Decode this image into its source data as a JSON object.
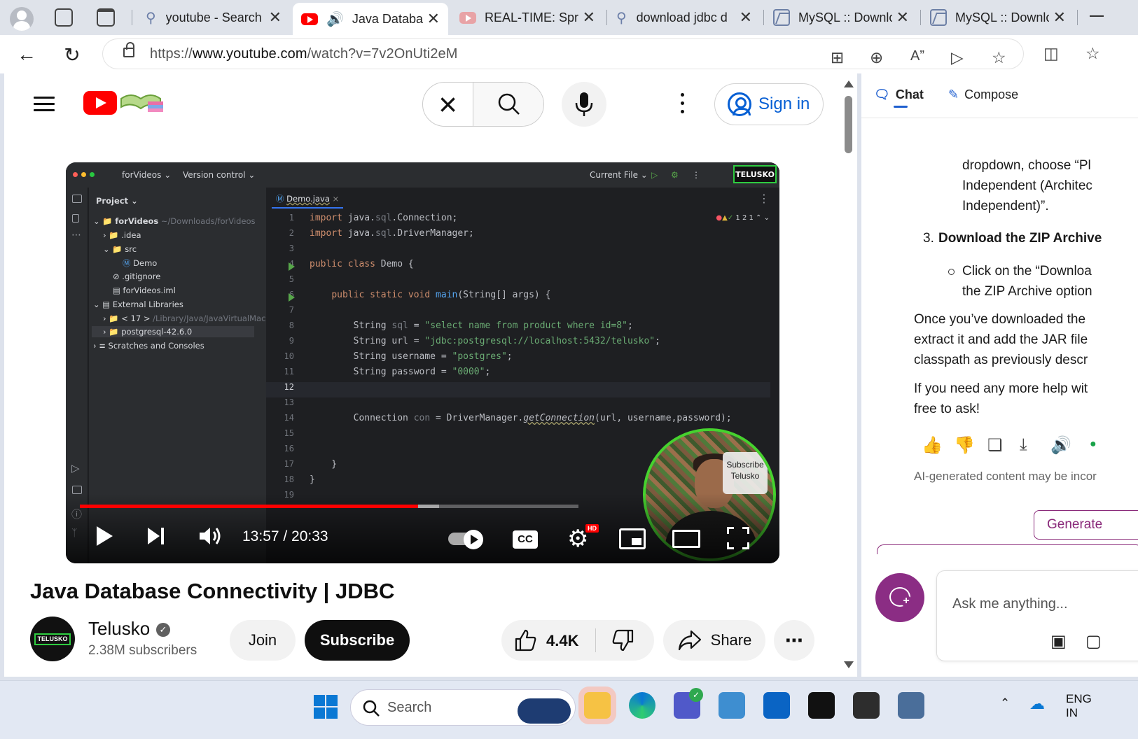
{
  "browser": {
    "tabs": [
      {
        "title": "youtube - Search",
        "icon": "search-icon"
      },
      {
        "title": "Java Databa",
        "icon": "youtube-icon",
        "active": true
      },
      {
        "title": "REAL-TIME: Sprin",
        "icon": "youtube-icon"
      },
      {
        "title": "download jdbc d",
        "icon": "search-icon"
      },
      {
        "title": "MySQL :: Downlo",
        "icon": "mysql-icon"
      },
      {
        "title": "MySQL :: Downlo",
        "icon": "mysql-icon"
      }
    ],
    "url_prefix": "https://",
    "url_host": "www.youtube.com",
    "url_path": "/watch?v=7v2OnUti2eM"
  },
  "youtube": {
    "signin_label": "Sign in",
    "video": {
      "title": "Java Database Connectivity | JDBC",
      "current_time": "13:57",
      "duration": "20:33",
      "time_display": "13:57 / 20:33",
      "progress_played": 0.679,
      "progress_buffered": 0.72,
      "cc_label": "CC",
      "hd_label": "HD"
    },
    "channel": {
      "name": "Telusko",
      "subscribers": "2.38M subscribers",
      "avatar_text": "TELUSKO"
    },
    "actions": {
      "join": "Join",
      "subscribe": "Subscribe",
      "likes": "4.4K",
      "share": "Share"
    }
  },
  "ide": {
    "project_name": "forVideos",
    "version_control": "Version control",
    "run_config": "Current File",
    "badge": "TELUSKO",
    "project_label": "Project",
    "tree": [
      {
        "label": "forVideos",
        "extra": "~/Downloads/forVideos"
      },
      {
        "label": ".idea"
      },
      {
        "label": "src"
      },
      {
        "label": "Demo"
      },
      {
        "label": ".gitignore"
      },
      {
        "label": "forVideos.iml"
      },
      {
        "label": "External Libraries"
      },
      {
        "label": "< 17 >",
        "extra": "/Library/Java/JavaVirtualMachir"
      },
      {
        "label": "postgresql-42.6.0"
      },
      {
        "label": "Scratches and Consoles"
      }
    ],
    "editor_tab": "Demo.java",
    "inspections": "1  2  1",
    "code": [
      "import java.sql.Connection;",
      "import java.sql.DriverManager;",
      "",
      "public class Demo {",
      "",
      "    public static void main(String[] args) {",
      "",
      "        String sql = \"select name from product where id=8\";",
      "        String url = \"jdbc:postgresql://localhost:5432/telusko\";",
      "        String username = \"postgres\";",
      "        String password = \"0000\";",
      "",
      "",
      "        Connection con = DriverManager.getConnection(url, username,password);",
      "",
      "",
      "    }",
      "}",
      ""
    ],
    "subscribe_overlay": "Subscribe Telusko"
  },
  "copilot": {
    "tab_chat": "Chat",
    "tab_compose": "Compose",
    "lines": [
      "dropdown, choose “Pl",
      "Independent (Architec",
      "Independent)”."
    ],
    "step3_number": "3.",
    "step3_title": "Download the ZIP Archive",
    "step3_sub": [
      "Click on the “Downloa",
      "the ZIP Archive option"
    ],
    "para1": [
      "Once you’ve downloaded the",
      "extract it and add the JAR file",
      "classpath as previously descr"
    ],
    "para2": [
      "If you need any more help wit",
      "free to ask!"
    ],
    "disclaimer": "AI-generated content may be incor",
    "generate_label": "Generate",
    "ask_placeholder": "Ask me anything..."
  },
  "taskbar": {
    "search_label": "Search",
    "language": "ENG",
    "language_sub": "IN"
  }
}
